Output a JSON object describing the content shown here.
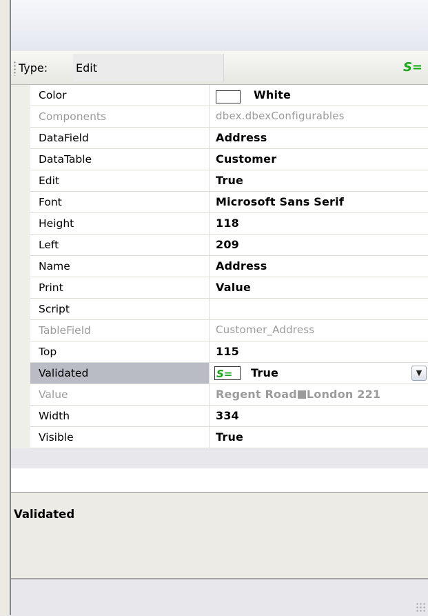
{
  "toolbar": {
    "type_label": "Type:",
    "type_value": "Edit",
    "script_badge": "S="
  },
  "properties": [
    {
      "name": "Color",
      "value": "White",
      "swatch": "#ffffff",
      "readonly": false
    },
    {
      "name": "Components",
      "value": "dbex.dbexConfigurables",
      "readonly": true
    },
    {
      "name": "DataField",
      "value": "Address",
      "readonly": false
    },
    {
      "name": "DataTable",
      "value": "Customer",
      "readonly": false
    },
    {
      "name": "Edit",
      "value": "True",
      "readonly": false
    },
    {
      "name": "Font",
      "value": "Microsoft Sans Serif",
      "readonly": false
    },
    {
      "name": "Height",
      "value": "118",
      "readonly": false
    },
    {
      "name": "Left",
      "value": "209",
      "readonly": false
    },
    {
      "name": "Name",
      "value": "Address",
      "readonly": false
    },
    {
      "name": "Print",
      "value": "Value",
      "readonly": false
    },
    {
      "name": "Script",
      "value": "",
      "readonly": false
    },
    {
      "name": "TableField",
      "value": "Customer_Address",
      "readonly": true
    },
    {
      "name": "Top",
      "value": "115",
      "readonly": false
    },
    {
      "name": "Validated",
      "value": "True",
      "icon": "S=",
      "selected": true,
      "readonly": false
    },
    {
      "name": "Value",
      "value_part1": "Regent Road",
      "value_part2": "London 221",
      "readonly": true
    },
    {
      "name": "Width",
      "value": "334",
      "readonly": false
    },
    {
      "name": "Visible",
      "value": "True",
      "readonly": false
    }
  ],
  "help": {
    "title": "Validated"
  }
}
